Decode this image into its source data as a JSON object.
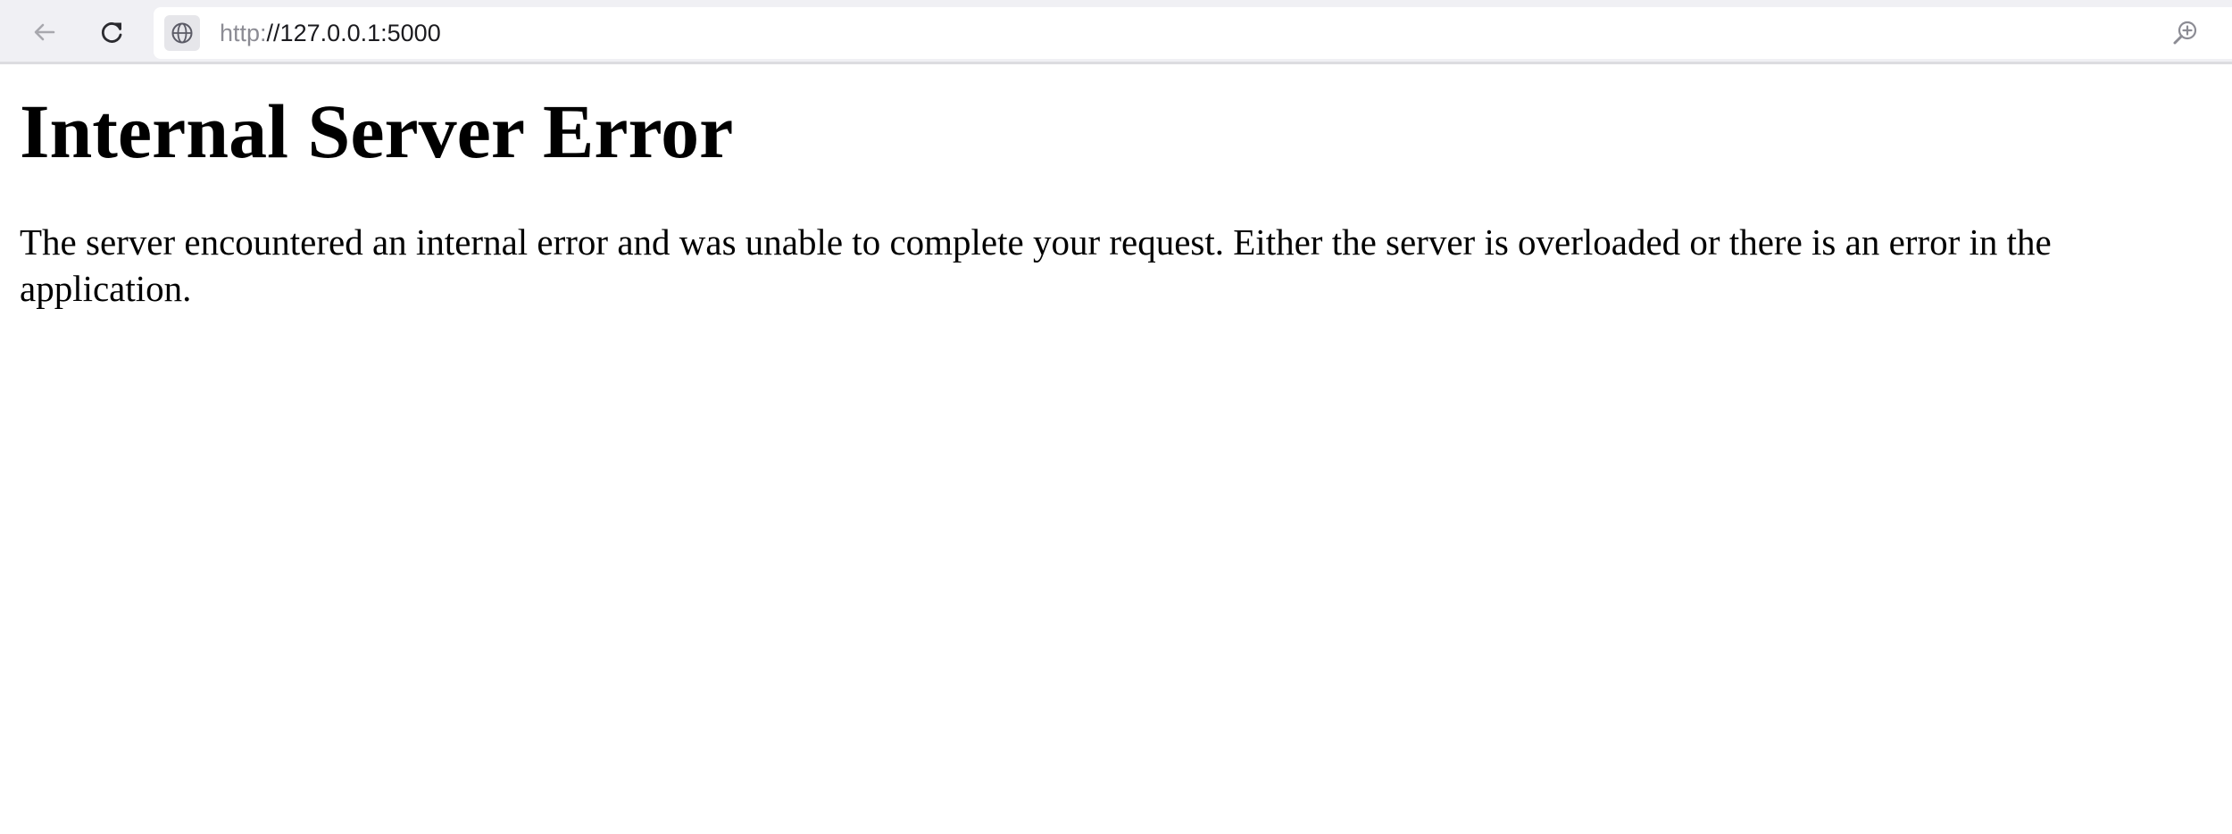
{
  "browser": {
    "url_scheme": "http:",
    "url_rest": "//127.0.0.1:5000",
    "icons": {
      "back": "arrow-left-icon",
      "reload": "reload-icon",
      "site": "globe-icon",
      "zoom": "zoom-in-icon"
    }
  },
  "page": {
    "title": "Internal Server Error",
    "message": "The server encountered an internal error and was unable to complete your request. Either the server is overloaded or there is an error in the application."
  },
  "colors": {
    "toolbar_bg": "#f0f0f4",
    "url_text": "#1b1b1f",
    "url_scheme": "#8c8c94",
    "page_text": "#000000"
  }
}
